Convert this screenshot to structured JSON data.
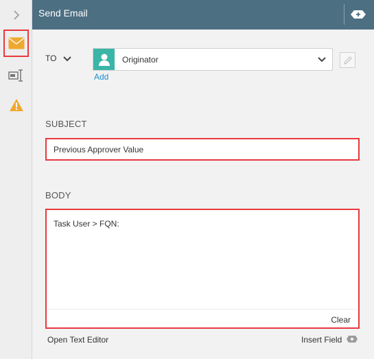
{
  "header": {
    "title": "Send Email"
  },
  "rail": {
    "items": [
      {
        "name": "expand",
        "icon": "chevron-right-icon"
      },
      {
        "name": "email",
        "icon": "envelope-icon",
        "selected": true
      },
      {
        "name": "field",
        "icon": "text-field-icon"
      },
      {
        "name": "warning",
        "icon": "warning-icon"
      }
    ]
  },
  "to": {
    "label": "TO",
    "recipient": "Originator",
    "add_label": "Add"
  },
  "subject": {
    "label": "SUBJECT",
    "value": "Previous Approver Value"
  },
  "body": {
    "label": "BODY",
    "value": "Task User > FQN:",
    "clear_label": "Clear"
  },
  "footer": {
    "open_editor": "Open Text Editor",
    "insert_field": "Insert Field"
  },
  "colors": {
    "header_bg": "#4d6f82",
    "highlight": "#e8383d",
    "avatar": "#3ab5a7",
    "envelope": "#f0a830",
    "warning": "#f0a830",
    "link": "#1a8fd1"
  }
}
